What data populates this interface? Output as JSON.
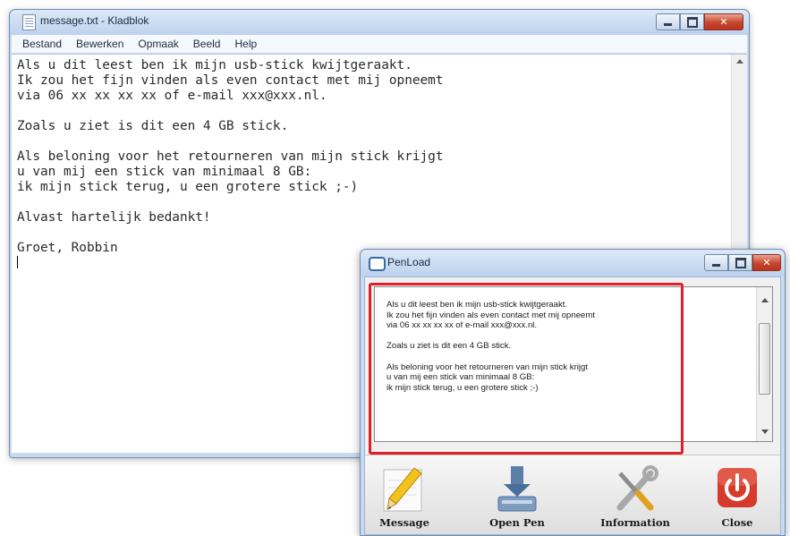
{
  "notepad": {
    "title": "message.txt - Kladblok",
    "menu": [
      "Bestand",
      "Bewerken",
      "Opmaak",
      "Beeld",
      "Help"
    ],
    "content": "Als u dit leest ben ik mijn usb-stick kwijtgeraakt.\nIk zou het fijn vinden als even contact met mij opneemt\nvia 06 xx xx xx xx of e-mail xxx@xxx.nl.\n\nZoals u ziet is dit een 4 GB stick.\n\nAls beloning voor het retourneren van mijn stick krijgt\nu van mij een stick van minimaal 8 GB:\nik mijn stick terug, u een grotere stick ;-)\n\nAlvast hartelijk bedankt!\n\nGroet, Robbin\n"
  },
  "penload": {
    "title": "PenLoad",
    "content": "Als u dit leest ben ik mijn usb-stick kwijtgeraakt.\nIk zou het fijn vinden als even contact met mij opneemt\nvia 06 xx xx xx xx of e-mail xxx@xxx.nl.\n\nZoals u ziet is dit een 4 GB stick.\n\nAls beloning voor het retourneren van mijn stick krijgt\nu van mij een stick van minimaal 8 GB:\nik mijn stick terug, u een grotere stick ;-)",
    "toolbar": [
      {
        "label": "Message",
        "icon": "pencil-icon"
      },
      {
        "label": "Open Pen",
        "icon": "usb-drive-icon"
      },
      {
        "label": "Information",
        "icon": "tools-icon"
      },
      {
        "label": "Close",
        "icon": "power-icon"
      }
    ]
  },
  "colors": {
    "highlight": "#e21e26",
    "close_red": "#c6452e",
    "title_bar": "#c9daf0"
  }
}
